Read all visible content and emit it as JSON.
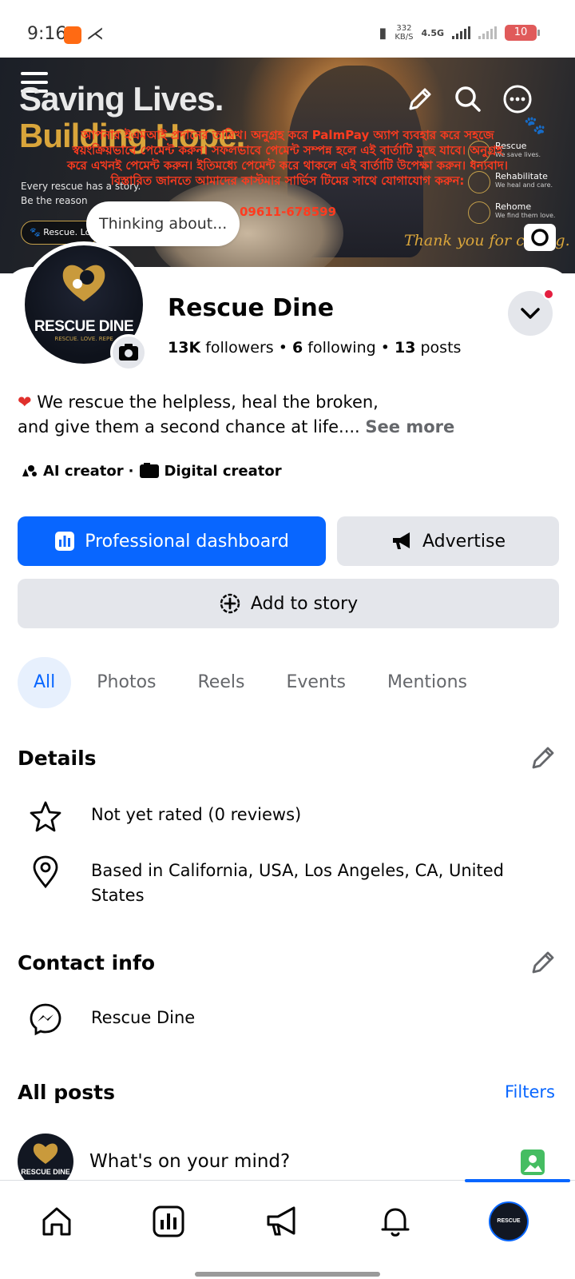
{
  "status_bar": {
    "time": "9:16",
    "network_speed_value": "332",
    "network_speed_unit": "KB/S",
    "network_type": "4.5G",
    "battery": "10"
  },
  "cover": {
    "headline_line1": "Saving Lives.",
    "headline_line2": "Building Hope.",
    "subtext_line1": "Every rescue has a story.",
    "subtext_line2": "Be the reason",
    "pill_label": "Rescue. Lo",
    "overlay_text": "আপনার ইএমআই প্রদানের তারিখ। অনুগ্রহ করে PalmPay অ্যাপ ব্যবহার করে সহজে স্বয়ংক্রিয়ভাবে পেমেন্ট করুন। সফলভাবে পেমেন্ট সম্পন্ন হলে এই বার্তাটি মুছে যাবে। অনুগ্রহ করে এখনই পেমেন্ট করুন। ইতিমধ্যে পেমেন্ট করে থাকলে এই বার্তাটি উপেক্ষা করুন। ধন্যবাদ। বিস্তারিত জানতে আমাদের কাস্টমার সার্ভিস টিমের সাথে যোগাযোগ করুন:",
    "overlay_phone": "09611-678599",
    "side_items": [
      {
        "title": "Rescue",
        "desc": "We save lives."
      },
      {
        "title": "Rehabilitate",
        "desc": "We heal and care."
      },
      {
        "title": "Rehome",
        "desc": "We find them love."
      }
    ],
    "thanks": "Thank you for caring."
  },
  "profile": {
    "thought_bubble": "Thinking about...",
    "avatar_logo_text": "RESCUE DINE",
    "avatar_tagline": "RESCUE. LOVE. REPE",
    "name": "Rescue Dine",
    "followers_count": "13K",
    "followers_label": "followers",
    "following_count": "6",
    "following_label": "following",
    "posts_count": "13",
    "posts_label": "posts",
    "separator": "•",
    "bio_line1": "We rescue the helpless, heal the broken,",
    "bio_line2": "and give them a second chance at life....",
    "see_more": "See more",
    "category_1": "AI creator",
    "category_sep": "·",
    "category_2": "Digital creator"
  },
  "actions": {
    "professional_dashboard": "Professional dashboard",
    "advertise": "Advertise",
    "add_to_story": "Add to story"
  },
  "tabs": [
    {
      "label": "All",
      "active": true
    },
    {
      "label": "Photos",
      "active": false
    },
    {
      "label": "Reels",
      "active": false
    },
    {
      "label": "Events",
      "active": false
    },
    {
      "label": "Mentions",
      "active": false
    }
  ],
  "details": {
    "title": "Details",
    "rating": "Not yet rated (0 reviews)",
    "location": "Based in California, USA, Los Angeles, CA, United States"
  },
  "contact": {
    "title": "Contact info",
    "messenger": "Rescue Dine"
  },
  "posts": {
    "title": "All posts",
    "filters": "Filters",
    "composer_placeholder": "What's on your mind?",
    "composer_avatar_text": "RESCUE DINE"
  },
  "bottom_nav": {
    "profile_avatar_text": "RESCUE DINE"
  },
  "colors": {
    "primary_blue": "#0866ff",
    "secondary_gray": "#e4e6eb",
    "notification_red": "#e41e3f",
    "overlay_red": "#ff3b1f",
    "cover_gold": "#d9a53b"
  },
  "icons": [
    "menu-icon",
    "pencil-icon",
    "search-icon",
    "more-icon",
    "camera-icon",
    "chevron-down-icon",
    "heart-icon",
    "ai-creator-icon",
    "digital-creator-icon",
    "dashboard-icon",
    "megaphone-icon",
    "add-story-icon",
    "star-icon",
    "location-pin-icon",
    "messenger-icon",
    "photo-icon",
    "home-icon",
    "dashboard-nav-icon",
    "megaphone-nav-icon",
    "bell-icon"
  ]
}
